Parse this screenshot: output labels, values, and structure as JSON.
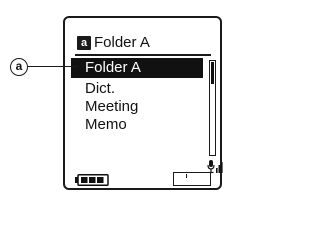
{
  "header": {
    "folder_icon_glyph": "a",
    "folder_icon": "folder-a-icon",
    "title": "Folder A"
  },
  "menu": {
    "items": [
      {
        "label": "Folder A",
        "selected": true
      },
      {
        "label": "Dict.",
        "selected": false
      },
      {
        "label": "Meeting",
        "selected": false
      },
      {
        "label": "Memo",
        "selected": false
      }
    ]
  },
  "status": {
    "battery_icon": "battery-icon",
    "mic_icon": "microphone-level-icon",
    "remaining_icon": "remaining-time-box"
  },
  "callout": {
    "label": "a"
  },
  "colors": {
    "ink": "#111111",
    "background": "#ffffff",
    "highlight_text": "#ffffff"
  }
}
